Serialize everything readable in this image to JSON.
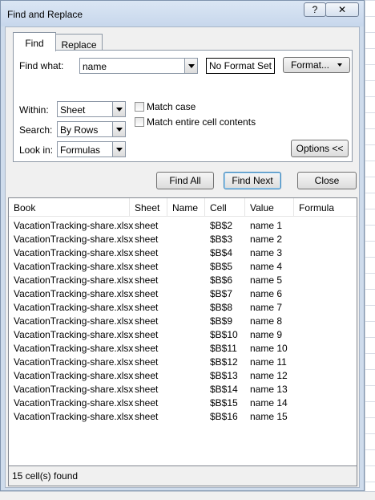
{
  "window": {
    "title": "Find and Replace",
    "help_label": "?",
    "close_label": "✕"
  },
  "tabs": [
    {
      "label": "Find"
    },
    {
      "label": "Replace"
    }
  ],
  "find": {
    "find_what_label": "Find what:",
    "find_what_value": "name",
    "no_format_label": "No Format Set",
    "format_label": "Format...",
    "within_label": "Within:",
    "within_value": "Sheet",
    "search_label": "Search:",
    "search_value": "By Rows",
    "lookin_label": "Look in:",
    "lookin_value": "Formulas",
    "match_case_label": "Match case",
    "match_entire_label": "Match entire cell contents",
    "options_label": "Options <<"
  },
  "actions": {
    "find_all": "Find All",
    "find_next": "Find Next",
    "close": "Close"
  },
  "results": {
    "columns": [
      "Book",
      "Sheet",
      "Name",
      "Cell",
      "Value",
      "Formula"
    ],
    "rows": [
      [
        "VacationTracking-share.xlsx",
        "sheet",
        "",
        "$B$2",
        "name 1",
        ""
      ],
      [
        "VacationTracking-share.xlsx",
        "sheet",
        "",
        "$B$3",
        "name 2",
        ""
      ],
      [
        "VacationTracking-share.xlsx",
        "sheet",
        "",
        "$B$4",
        "name 3",
        ""
      ],
      [
        "VacationTracking-share.xlsx",
        "sheet",
        "",
        "$B$5",
        "name 4",
        ""
      ],
      [
        "VacationTracking-share.xlsx",
        "sheet",
        "",
        "$B$6",
        "name 5",
        ""
      ],
      [
        "VacationTracking-share.xlsx",
        "sheet",
        "",
        "$B$7",
        "name 6",
        ""
      ],
      [
        "VacationTracking-share.xlsx",
        "sheet",
        "",
        "$B$8",
        "name 7",
        ""
      ],
      [
        "VacationTracking-share.xlsx",
        "sheet",
        "",
        "$B$9",
        "name 8",
        ""
      ],
      [
        "VacationTracking-share.xlsx",
        "sheet",
        "",
        "$B$10",
        "name 9",
        ""
      ],
      [
        "VacationTracking-share.xlsx",
        "sheet",
        "",
        "$B$11",
        "name 10",
        ""
      ],
      [
        "VacationTracking-share.xlsx",
        "sheet",
        "",
        "$B$12",
        "name 11",
        ""
      ],
      [
        "VacationTracking-share.xlsx",
        "sheet",
        "",
        "$B$13",
        "name 12",
        ""
      ],
      [
        "VacationTracking-share.xlsx",
        "sheet",
        "",
        "$B$14",
        "name 13",
        ""
      ],
      [
        "VacationTracking-share.xlsx",
        "sheet",
        "",
        "$B$15",
        "name 14",
        ""
      ],
      [
        "VacationTracking-share.xlsx",
        "sheet",
        "",
        "$B$16",
        "name 15",
        ""
      ]
    ],
    "status": "15 cell(s) found"
  }
}
